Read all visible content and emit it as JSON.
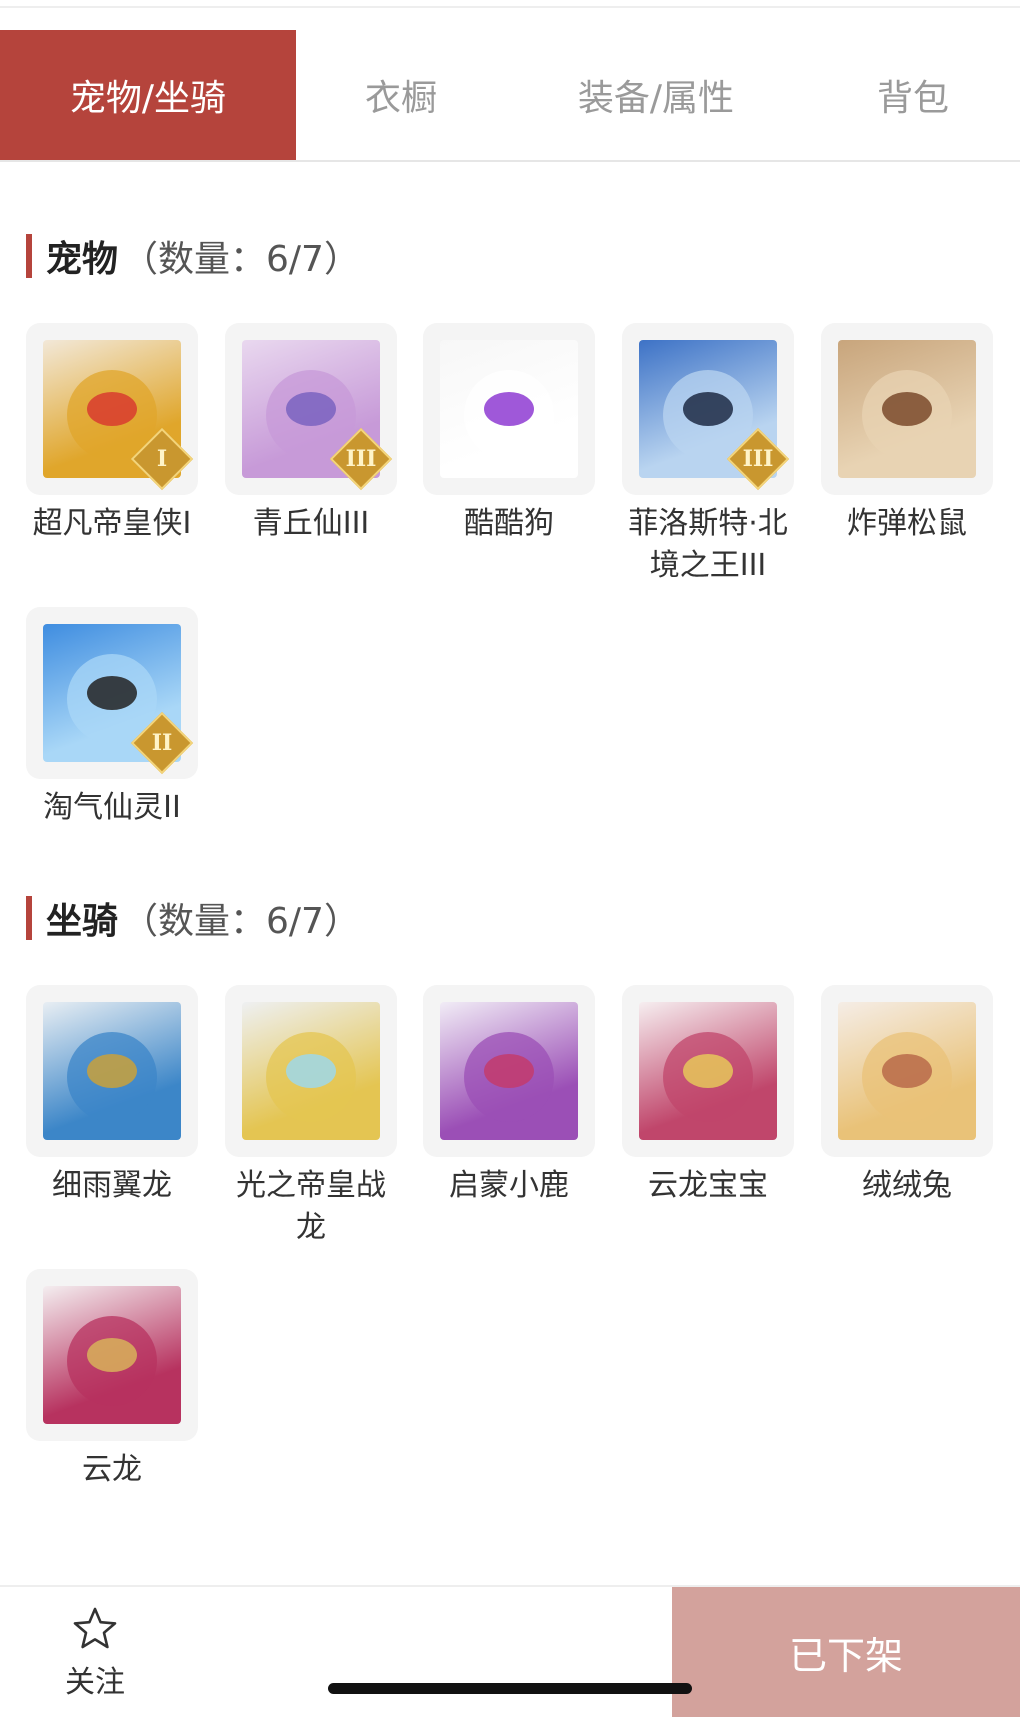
{
  "tabs": [
    {
      "label": "宠物/坐骑",
      "active": true
    },
    {
      "label": "衣橱",
      "active": false
    },
    {
      "label": "装备/属性",
      "active": false
    },
    {
      "label": "背包",
      "active": false
    }
  ],
  "pets": {
    "title": "宠物",
    "count": "（数量：6/7）",
    "items": [
      {
        "name": "超凡帝皇侠I",
        "badge": "I",
        "colors": [
          "#f2e8d8",
          "#e0a62b",
          "#d83b2f"
        ]
      },
      {
        "name": "青丘仙III",
        "badge": "III",
        "colors": [
          "#e9d8ef",
          "#c79ad8",
          "#7a63c0"
        ]
      },
      {
        "name": "酷酷狗",
        "badge": "",
        "colors": [
          "#f7f7f7",
          "#ffffff",
          "#8e3bd2"
        ]
      },
      {
        "name": "菲洛斯特·北境之王III",
        "badge": "III",
        "colors": [
          "#3d72c6",
          "#b9d4f0",
          "#1d2a44"
        ]
      },
      {
        "name": "炸弹松鼠",
        "badge": "",
        "colors": [
          "#c8a57c",
          "#e8d3b3",
          "#7a4a2c"
        ]
      },
      {
        "name": "淘气仙灵II",
        "badge": "II",
        "colors": [
          "#3f8de0",
          "#a9d7f7",
          "#222222"
        ]
      }
    ]
  },
  "mounts": {
    "title": "坐骑",
    "count": "（数量：6/7）",
    "items": [
      {
        "name": "细雨翼龙",
        "badge": "",
        "colors": [
          "#e8eef3",
          "#3c86c8",
          "#c9a13b"
        ]
      },
      {
        "name": "光之帝皇战龙",
        "badge": "",
        "colors": [
          "#eef0f2",
          "#e4c552",
          "#9fd8ea"
        ]
      },
      {
        "name": "启蒙小鹿",
        "badge": "",
        "colors": [
          "#f1ecf6",
          "#9b4fb6",
          "#c33b6c"
        ]
      },
      {
        "name": "云龙宝宝",
        "badge": "",
        "colors": [
          "#f6eef0",
          "#c0466b",
          "#e6c75a"
        ]
      },
      {
        "name": "绒绒兔",
        "badge": "",
        "colors": [
          "#f5ede6",
          "#e9c278",
          "#b86a4a"
        ]
      },
      {
        "name": "云龙",
        "badge": "",
        "colors": [
          "#f4eef0",
          "#b7325f",
          "#d8b25a"
        ]
      }
    ]
  },
  "bottom": {
    "follow_label": "关注",
    "offshelf_label": "已下架"
  }
}
